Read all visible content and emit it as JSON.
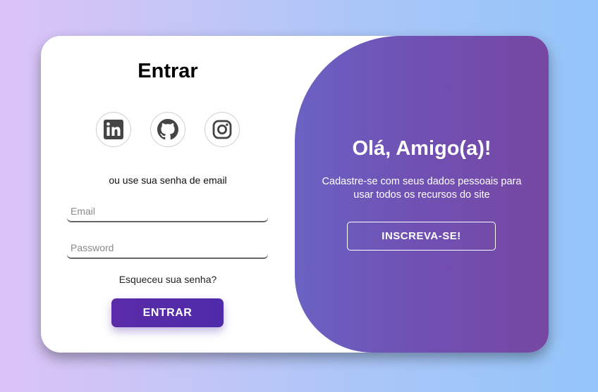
{
  "login": {
    "title": "Entrar",
    "socials": [
      {
        "icon": "linkedin-icon"
      },
      {
        "icon": "github-icon"
      },
      {
        "icon": "instagram-icon"
      }
    ],
    "alt_text": "ou use sua senha de email",
    "email": {
      "placeholder": "Email",
      "value": ""
    },
    "password": {
      "placeholder": "Password",
      "value": ""
    },
    "forgot": "Esqueceu sua senha?",
    "submit_label": "ENTRAR"
  },
  "signup_panel": {
    "title": "Olá, Amigo(a)!",
    "description": "Cadastre-se com seus dados pessoais para usar todos os recursos do site",
    "button_label": "INSCREVA-SE!"
  },
  "colors": {
    "primary_button": "#5a2ba8",
    "panel_gradient_start": "#6a62c3",
    "panel_gradient_end": "#7648a3",
    "icon_gray": "#444444"
  }
}
